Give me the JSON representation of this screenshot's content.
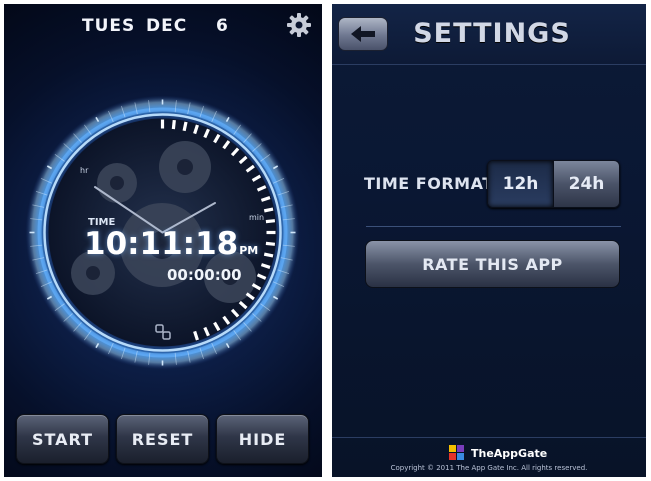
{
  "date": {
    "day": "TUES",
    "month": "DEC",
    "day_number": "6"
  },
  "clock": {
    "label": "TIME",
    "time": "10:11:18",
    "ampm": "PM",
    "stopwatch": "00:00:00",
    "min_label": "min",
    "hr_label": "hr"
  },
  "buttons": {
    "start": "START",
    "reset": "RESET",
    "hide": "HIDE"
  },
  "settings": {
    "title": "SETTINGS",
    "time_format_label": "TIME FORMAT",
    "format_options": [
      "12h",
      "24h"
    ],
    "selected_format": "12h",
    "rate_button": "RATE THIS APP"
  },
  "footer": {
    "brand": "TheAppGate",
    "copyright": "Copyright © 2011 The App Gate Inc. All rights reserved."
  },
  "colors": {
    "accent_blue": "#6fb6ff",
    "dark_navy": "#06102a"
  }
}
